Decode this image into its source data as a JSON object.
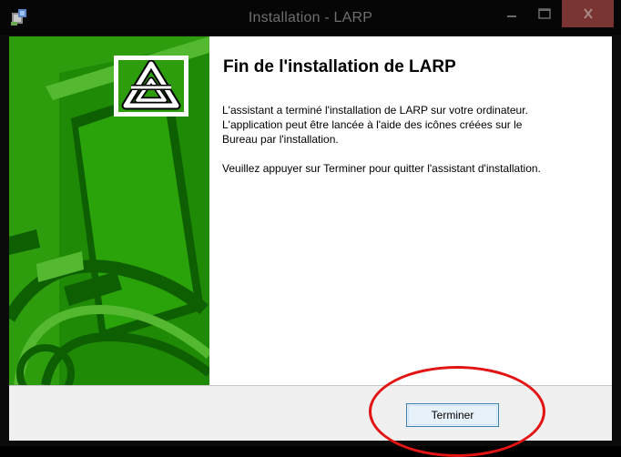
{
  "window": {
    "title": "Installation - LARP"
  },
  "title_controls": {
    "minimize_icon": "minimize-icon",
    "maximize_icon": "maximize-icon",
    "close_icon": "close-icon",
    "close_color": "#7a3432"
  },
  "wizard": {
    "heading": "Fin de l'installation de LARP",
    "paragraph1_lines": [
      "L'assistant a terminé l'installation de LARP sur votre ordinateur.",
      "L'application peut être lancée à l'aide des icônes créées sur le",
      "Bureau par l'installation."
    ],
    "paragraph2": "Veuillez appuyer sur Terminer pour quitter l'assistant d'installation.",
    "side_color": "#2d9d0d",
    "logo_icon": "larp-logo-icon"
  },
  "footer": {
    "finish_label": "Terminer"
  },
  "annotation": {
    "color": "#e21414"
  }
}
